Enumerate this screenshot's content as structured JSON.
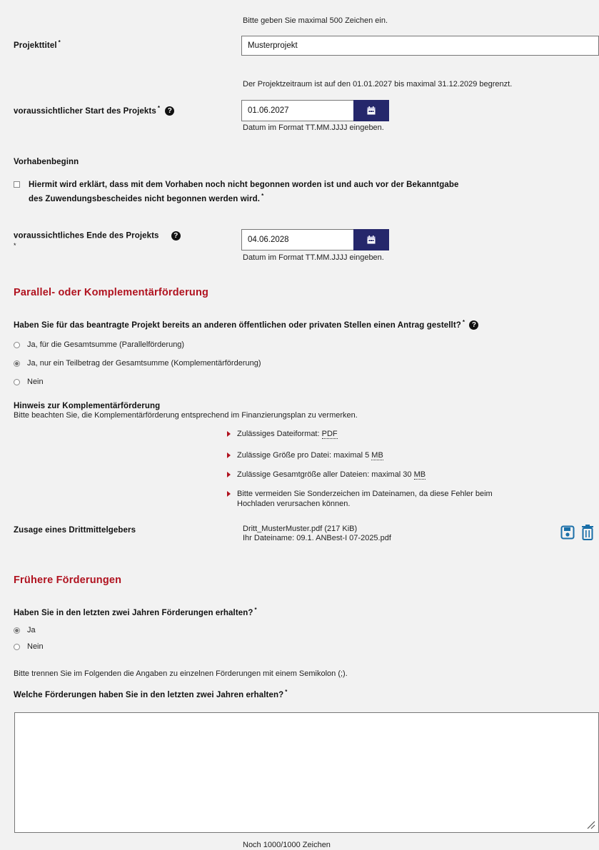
{
  "projekttitel": {
    "hint": "Bitte geben Sie maximal 500 Zeichen ein.",
    "label": "Projekttitel",
    "required": "*",
    "value": "Musterprojekt"
  },
  "start": {
    "hint": "Der Projektzeitraum ist auf den 01.01.2027 bis maximal 31.12.2029 begrenzt.",
    "label": "voraussichtlicher Start des Projekts",
    "required": "*",
    "value": "01.06.2027",
    "format_hint": "Datum im Format TT.MM.JJJJ eingeben."
  },
  "vorhabenbeginn": {
    "heading": "Vorhabenbeginn",
    "checkbox_line1": "Hiermit wird erklärt, dass mit dem Vorhaben noch nicht begonnen worden ist und auch vor der Bekanntgabe",
    "checkbox_line2": "des Zuwendungsbescheides nicht begonnen werden wird.",
    "required": "*",
    "checked": false
  },
  "ende": {
    "label": "voraussichtliches Ende des Projekts",
    "required": "*",
    "value": "04.06.2028",
    "format_hint": "Datum im Format TT.MM.JJJJ eingeben."
  },
  "parallel": {
    "section_title": "Parallel- oder Komplementärförderung",
    "question": "Haben Sie für das beantragte Projekt bereits an anderen öffentlichen oder privaten Stellen einen Antrag gestellt?",
    "required": "*",
    "options": [
      "Ja, für die Gesamtsumme (Parallelförderung)",
      "Ja, nur ein Teilbetrag der Gesamtsumme (Komplementärförderung)",
      "Nein"
    ],
    "selected_index": 1,
    "hinweis_title": "Hinweis zur Komplementärförderung",
    "hinweis_text": "Bitte beachten Sie, die Komplementärförderung entsprechend im Finanzierungsplan zu vermerken.",
    "rules": {
      "format_prefix": "Zulässiges Dateiformat: ",
      "format_value": "PDF",
      "size_prefix": "Zulässige Größe pro Datei: maximal 5 ",
      "size_unit": "MB",
      "total_prefix": "Zulässige Gesamtgröße aller Dateien: maximal 30 ",
      "total_unit": "MB",
      "special_line1": "Bitte vermeiden Sie Sonderzeichen im Dateinamen, da diese Fehler beim",
      "special_line2": "Hochladen verursachen können."
    },
    "upload_label": "Zusage eines Drittmittelgebers",
    "file_name": "Dritt_MusterMuster.pdf (217 KiB)",
    "file_original": "Ihr Dateiname: 09.1. ANBest-I 07-2025.pdf",
    "save_icon": "floppy-disk-icon",
    "delete_icon": "trash-icon",
    "accent_color": "#1a6fa8"
  },
  "frueher": {
    "section_title": "Frühere Förderungen",
    "question": "Haben Sie in den letzten zwei Jahren Förderungen erhalten?",
    "required": "*",
    "options": [
      "Ja",
      "Nein"
    ],
    "selected_index": 0,
    "separator_hint": "Bitte trennen Sie im Folgenden die Angaben zu einzelnen Förderungen mit einem Semikolon (;).",
    "textarea_label": "Welche Förderungen haben Sie in den letzten zwei Jahren erhalten?",
    "textarea_value": "",
    "counter": "Noch 1000/1000 Zeichen"
  },
  "colors": {
    "section_title": "#b0121f",
    "calendar_button": "#25276b",
    "background": "#f2f2f2"
  }
}
